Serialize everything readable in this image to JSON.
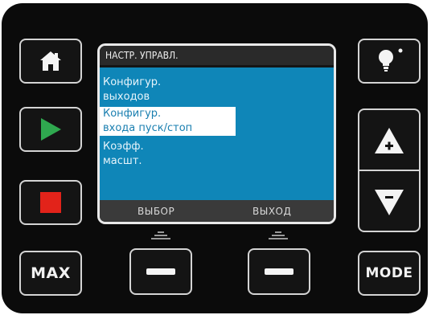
{
  "screen": {
    "header_title": "НАСТР. УПРАВЛ.",
    "menu_items": [
      {
        "line1": "Конфигур.",
        "line2": "выходов",
        "selected": false
      },
      {
        "line1": "Конфигур.",
        "line2": "входа пуск/стоп",
        "selected": true
      },
      {
        "line1": "Коэфф.",
        "line2": "масшт.",
        "selected": false
      }
    ],
    "softkeys": {
      "left": "ВЫБОР",
      "right": "ВЫХОД"
    }
  },
  "buttons": {
    "max_label": "MAX",
    "mode_label": "MODE",
    "home_icon": "home-icon",
    "play_icon": "play-icon",
    "stop_icon": "stop-icon",
    "light_icon": "lightbulb-icon",
    "up_icon": "arrow-up-plus-icon",
    "down_icon": "arrow-down-minus-icon"
  },
  "colors": {
    "screen_bg": "#0f86b8",
    "play": "#2fa84f",
    "stop": "#e2231a",
    "panel": "#0b0b0b"
  }
}
